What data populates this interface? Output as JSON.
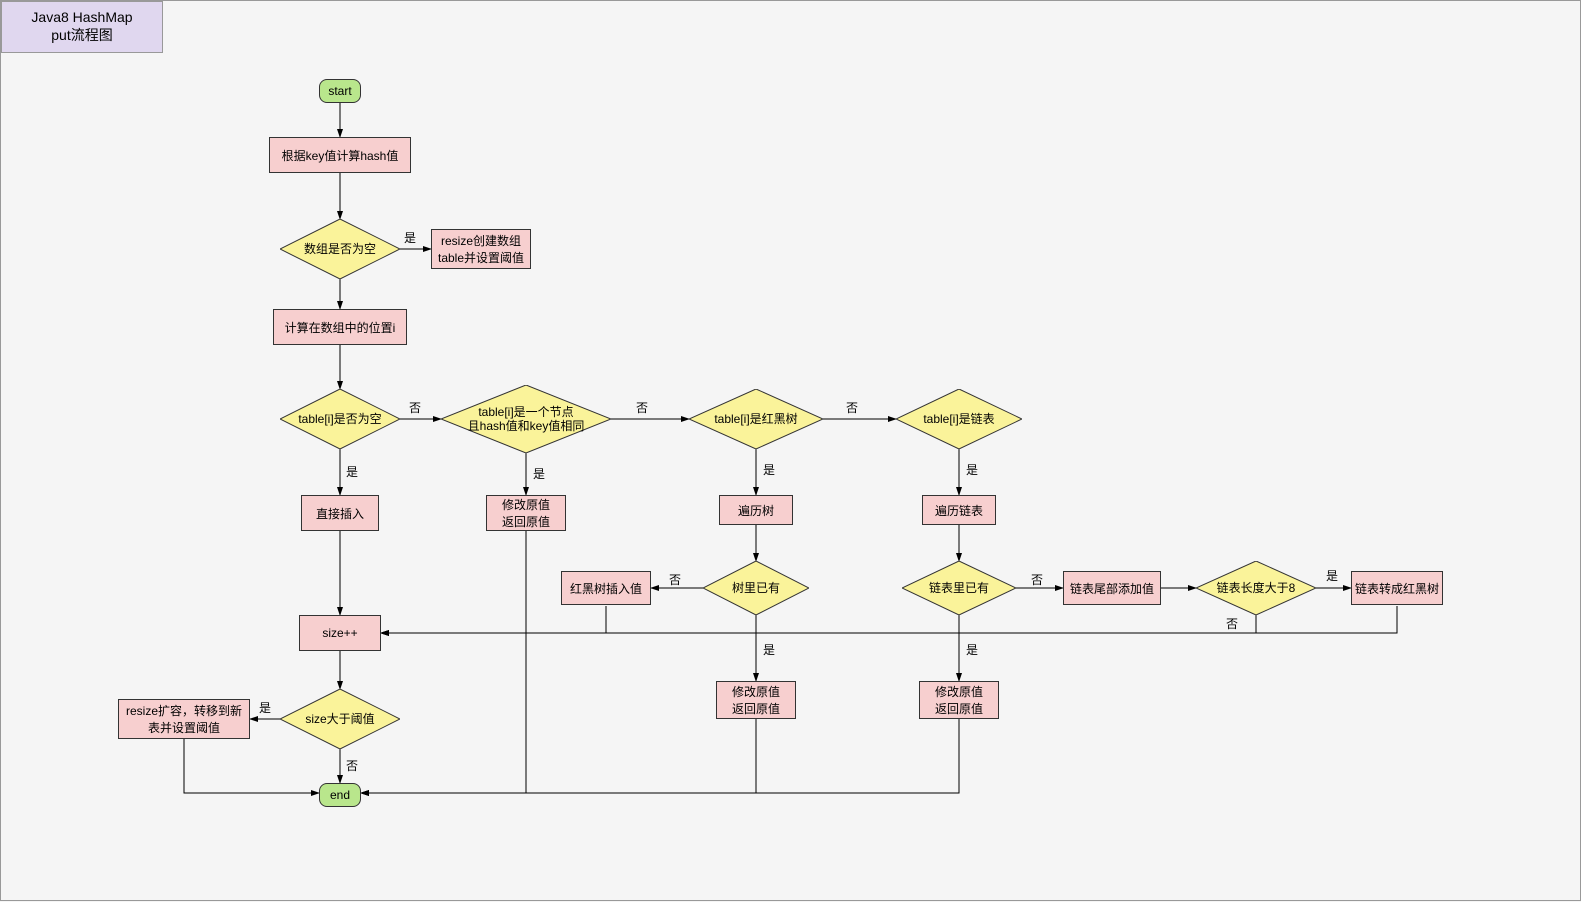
{
  "title": "Java8 HashMap\nput流程图",
  "labels": {
    "yes": "是",
    "no": "否"
  },
  "nodes": {
    "start": "start",
    "end": "end",
    "calcHash": "根据key值计算hash值",
    "arrayEmpty": "数组是否为空",
    "resizeCreate": "resize创建数组\ntable并设置阈值",
    "calcIndex": "计算在数组中的位置i",
    "tableIEmpty": "table[i]是否为空",
    "directInsert": "直接插入",
    "sizePlus": "size++",
    "sizeGt": "size大于阈值",
    "resizeExpand": "resize扩容，转移到新\n表并设置阈值",
    "sameNode": "table[i]是一个节点\n且hash值和key值相同",
    "modifyReturn1": "修改原值\n返回原值",
    "isRBTree": "table[i]是红黑树",
    "traverseTree": "遍历树",
    "treeHas": "树里已有",
    "rbInsert": "红黑树插入值",
    "modifyReturn2": "修改原值\n返回原值",
    "isList": "table[i]是链表",
    "traverseList": "遍历链表",
    "listHas": "链表里已有",
    "listAppend": "链表尾部添加值",
    "listLenGt8": "链表长度大于8",
    "listToRB": "链表转成红黑树",
    "modifyReturn3": "修改原值\n返回原值"
  }
}
